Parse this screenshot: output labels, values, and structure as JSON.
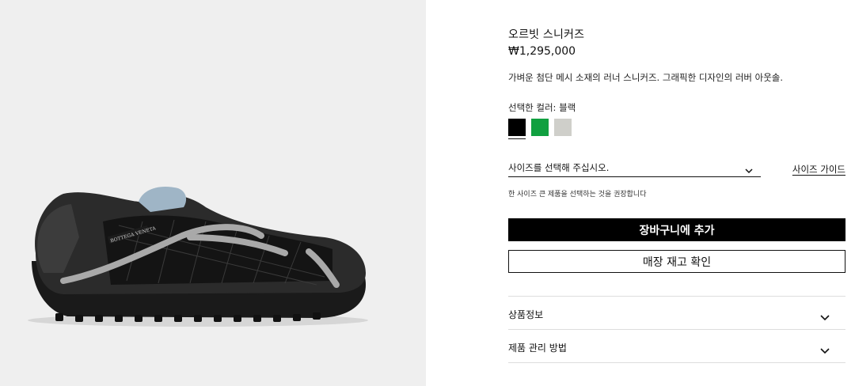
{
  "product": {
    "title": "오르빗 스니커즈",
    "price": "₩1,295,000",
    "description": "가벼운 첨단 메시 소재의 러너 스니커즈. 그래픽한 디자인의 러버 아웃솔.",
    "color_label": "선택한 컬러: 블랙",
    "image_logo_text": "BOTTEGA VENETA",
    "swatches": [
      {
        "name": "블랙",
        "color": "#000000",
        "selected": true
      },
      {
        "name": "그린",
        "color": "#10a040",
        "selected": false
      },
      {
        "name": "라이트 그레이",
        "color": "#cfcfca",
        "selected": false
      }
    ]
  },
  "size": {
    "placeholder": "사이즈를 선택해 주십시오.",
    "guide_label": "사이즈 가이드",
    "note": "한 사이즈 큰 제품을 선택하는 것을 권장합니다"
  },
  "actions": {
    "add_to_cart": "장바구니에 추가",
    "check_stock": "매장 재고 확인"
  },
  "accordion": [
    {
      "label": "상품정보"
    },
    {
      "label": "제품 관리 방법"
    }
  ],
  "colors": {
    "image_bg": "#efefef",
    "primary": "#000000",
    "divider": "#dddddd"
  }
}
